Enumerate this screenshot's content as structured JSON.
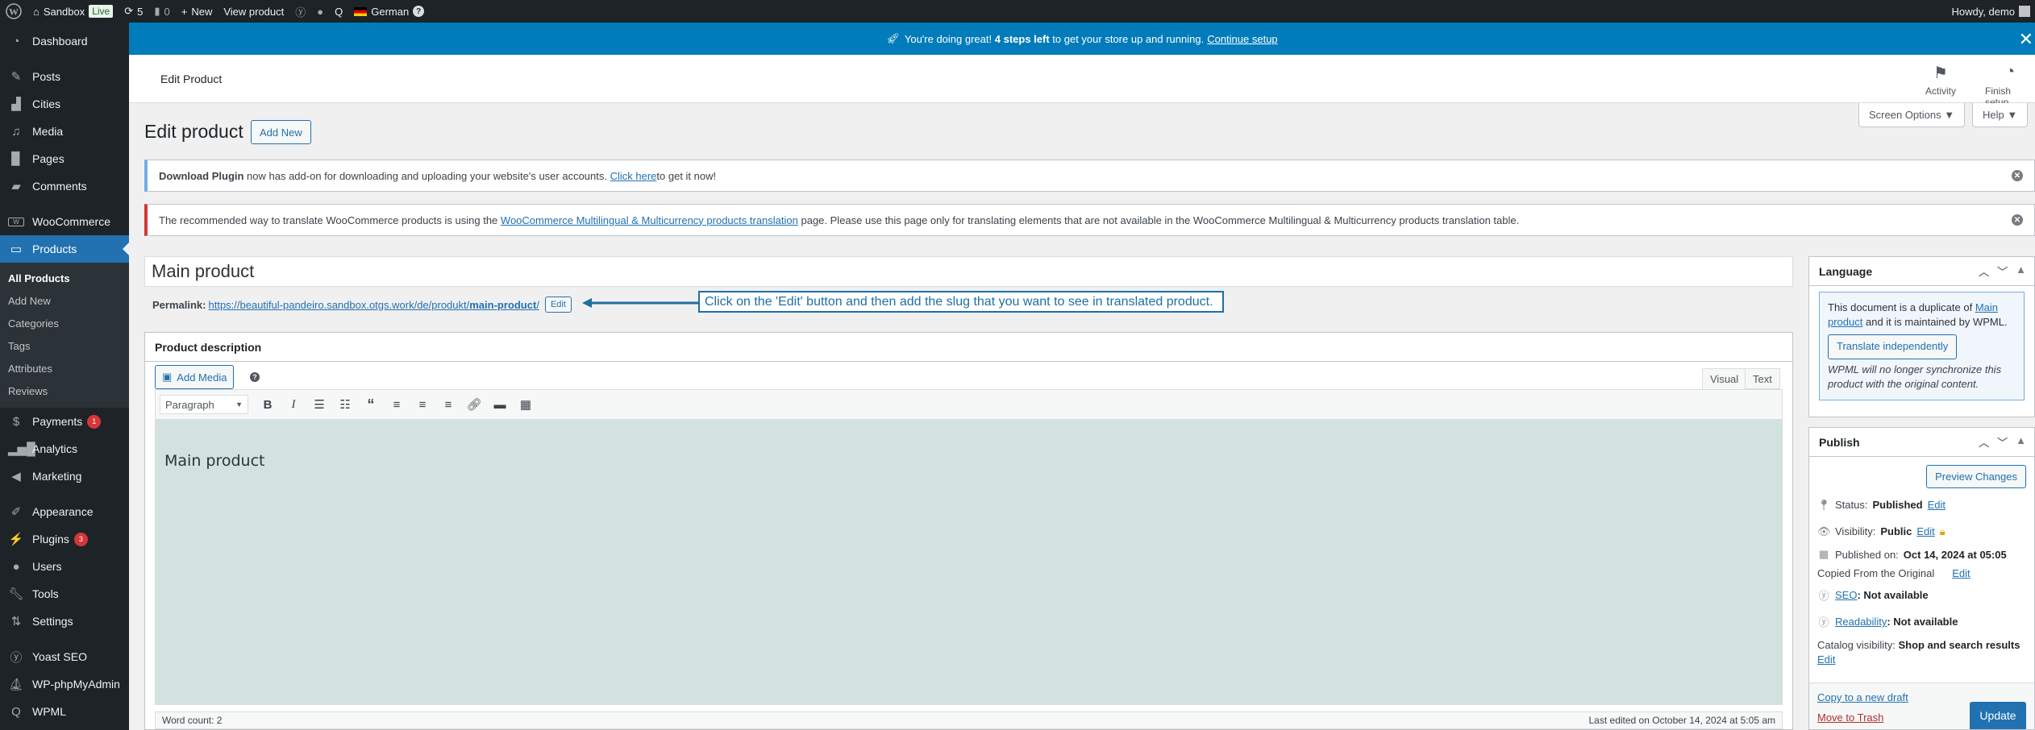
{
  "adminbar": {
    "site_name": "Sandbox",
    "live_badge": "Live",
    "updates_count": "5",
    "comments_count": "0",
    "new_label": "New",
    "view_product_label": "View product",
    "language_label": "German",
    "language_help": "?",
    "greeting": "Howdy, demo"
  },
  "setup_notice": {
    "text_before": "You're doing great!",
    "bold": "4 steps left",
    "text_after": "to get your store up and running.",
    "link": "Continue setup",
    "close": "✕"
  },
  "header": {
    "title": "Edit Product",
    "activity_label": "Activity",
    "finish_setup_label": "Finish setup"
  },
  "screen_options": {
    "label": "Screen Options ▼"
  },
  "help": {
    "label": "Help ▼"
  },
  "sidebar": {
    "items": [
      {
        "label": "Dashboard",
        "icon": "dashboard-icon"
      },
      {
        "label": "Posts",
        "icon": "pin-icon"
      },
      {
        "label": "Cities",
        "icon": "map-icon"
      },
      {
        "label": "Media",
        "icon": "media-icon"
      },
      {
        "label": "Pages",
        "icon": "pages-icon"
      },
      {
        "label": "Comments",
        "icon": "comment-icon"
      },
      {
        "label": "WooCommerce",
        "icon": "woo-icon"
      },
      {
        "label": "Products",
        "icon": "archive-icon"
      },
      {
        "label": "Payments",
        "icon": "dollar-icon",
        "badge": "1"
      },
      {
        "label": "Analytics",
        "icon": "bar-chart-icon"
      },
      {
        "label": "Marketing",
        "icon": "megaphone-icon"
      },
      {
        "label": "Appearance",
        "icon": "brush-icon"
      },
      {
        "label": "Plugins",
        "icon": "plug-icon",
        "badge": "3"
      },
      {
        "label": "Users",
        "icon": "user-icon"
      },
      {
        "label": "Tools",
        "icon": "wrench-icon"
      },
      {
        "label": "Settings",
        "icon": "settings-icon"
      },
      {
        "label": "Yoast SEO",
        "icon": "yoast-icon"
      },
      {
        "label": "WP-phpMyAdmin",
        "icon": "phpmyadmin-icon"
      },
      {
        "label": "WPML",
        "icon": "wpml-icon"
      }
    ],
    "submenu": [
      "All Products",
      "Add New",
      "Categories",
      "Tags",
      "Attributes",
      "Reviews"
    ]
  },
  "page": {
    "title": "Edit product",
    "add_new_label": "Add New"
  },
  "notices": {
    "download": {
      "bold": "Download Plugin",
      "text": " now has add-on for downloading and uploading your website's user accounts. ",
      "link": "Click here ",
      "after": "to get it now!"
    },
    "wcml": {
      "before": "The recommended way to translate WooCommerce products is using the ",
      "link": "WooCommerce Multilingual & Multicurrency products translation",
      "after": " page. Please use this page only for translating elements that are not available in the WooCommerce Multilingual & Multicurrency products translation table."
    }
  },
  "post": {
    "title": "Main product",
    "permalink_label": "Permalink:",
    "permalink_base": "https://beautiful-pandeiro.sandbox.otgs.work/de/produkt/",
    "permalink_slug": "main-product",
    "permalink_end": "/",
    "permalink_edit": "Edit"
  },
  "callout": {
    "text": "Click on the 'Edit' button and then add the slug that you want to see in translated product."
  },
  "editor": {
    "box_title": "Product description",
    "add_media": "Add Media",
    "help": "?",
    "tab_visual": "Visual",
    "tab_text": "Text",
    "format": "Paragraph",
    "content": "Main product",
    "word_count": "Word count: 2",
    "last_edited": "Last edited on October 14, 2024 at 5:05 am"
  },
  "language_box": {
    "title": "Language",
    "text1": "This document is a duplicate of ",
    "link": "Main product",
    "text2": " and it is maintained by WPML.",
    "button": "Translate independently",
    "note": "WPML will no longer synchronize this product with the original content."
  },
  "publish_box": {
    "title": "Publish",
    "preview": "Preview Changes",
    "status_label": "Status:",
    "status_value": "Published",
    "visibility_label": "Visibility:",
    "visibility_value": "Public",
    "published_label": "Published on:",
    "published_value": "Oct 14, 2024 at 05:05",
    "copied": "Copied From the Original",
    "seo_link": "SEO",
    "seo_value": ": Not available",
    "readability_link": "Readability",
    "readability_value": ": Not available",
    "catalog_label": "Catalog visibility:",
    "catalog_value": "Shop and search results",
    "edit": "Edit",
    "copy_draft": "Copy to a new draft",
    "trash": "Move to Trash",
    "update": "Update"
  }
}
